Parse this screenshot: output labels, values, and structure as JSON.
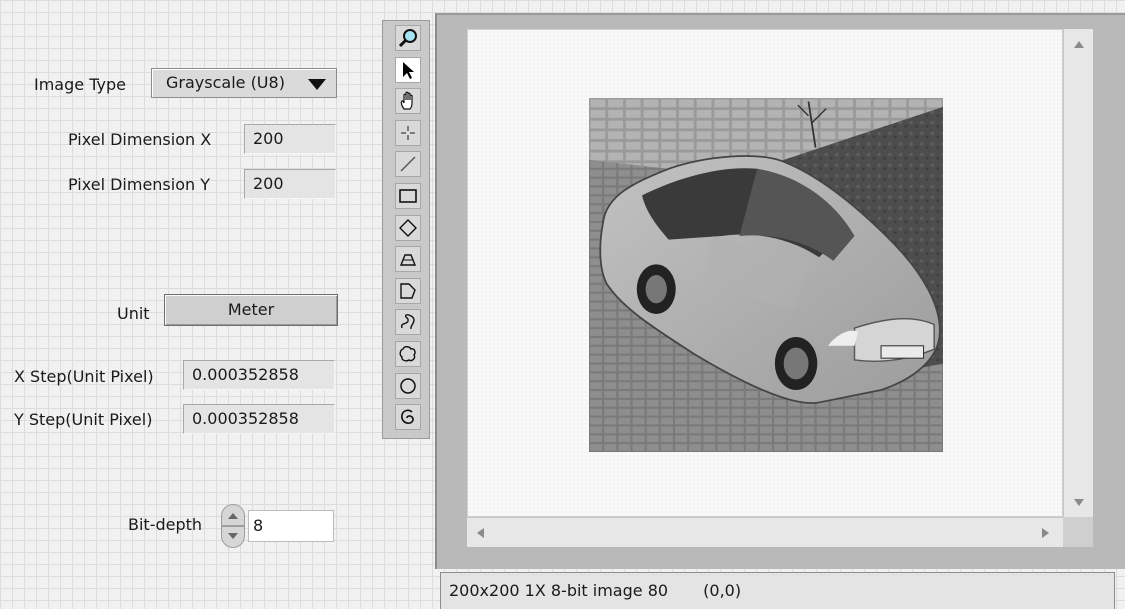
{
  "image_type": {
    "label": "Image Type",
    "value": "Grayscale (U8)"
  },
  "pixel_dimension_x": {
    "label": "Pixel Dimension X",
    "value": "200"
  },
  "pixel_dimension_y": {
    "label": "Pixel Dimension Y",
    "value": "200"
  },
  "unit": {
    "label": "Unit",
    "value": "Meter"
  },
  "x_step": {
    "label": "X Step(Unit Pixel)",
    "value": "0.000352858"
  },
  "y_step": {
    "label": "Y Step(Unit Pixel)",
    "value": "0.000352858"
  },
  "bit_depth": {
    "label": "Bit-depth",
    "value": "8"
  },
  "tools": [
    {
      "name": "zoom-tool",
      "icon": "magnifier-icon",
      "active": false
    },
    {
      "name": "selection-tool",
      "icon": "arrow-pointer-icon",
      "active": true
    },
    {
      "name": "pan-tool",
      "icon": "hand-icon",
      "active": false
    },
    {
      "name": "point-tool",
      "icon": "crosshair-icon",
      "active": false
    },
    {
      "name": "line-tool",
      "icon": "line-icon",
      "active": false
    },
    {
      "name": "rectangle-tool",
      "icon": "rectangle-icon",
      "active": false
    },
    {
      "name": "rotated-rectangle-tool",
      "icon": "diamond-icon",
      "active": false
    },
    {
      "name": "annulus-tool",
      "icon": "annulus-icon",
      "active": false
    },
    {
      "name": "polygon-tool",
      "icon": "polygon-icon",
      "active": false
    },
    {
      "name": "freehand-line-tool",
      "icon": "freehand-line-icon",
      "active": false
    },
    {
      "name": "freehand-region-tool",
      "icon": "freehand-region-icon",
      "active": false
    },
    {
      "name": "oval-tool",
      "icon": "oval-icon",
      "active": false
    },
    {
      "name": "spiral-tool",
      "icon": "spiral-icon",
      "active": false
    }
  ],
  "display": {
    "image_info": "200x200 1X 8-bit image 80",
    "coordinates": "(0,0)"
  }
}
